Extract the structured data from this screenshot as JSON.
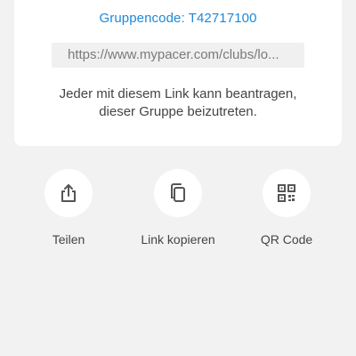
{
  "invite": {
    "group_code": "Gruppencode: T42717100",
    "link": "https://www.mypacer.com/clubs/lo...",
    "info_line1": "Jeder mit diesem Link kann beantragen,",
    "info_line2": "dieser Gruppe beizutreten."
  },
  "actions": [
    {
      "label": "Teilen",
      "icon": "share-icon"
    },
    {
      "label": "Link kopieren",
      "icon": "copy-icon"
    },
    {
      "label": "QR Code",
      "icon": "qr-code-icon"
    }
  ],
  "colors": {
    "accent": "#1e88d8",
    "background": "#f2f2f2",
    "card": "#ffffff",
    "icon": "#555555"
  }
}
